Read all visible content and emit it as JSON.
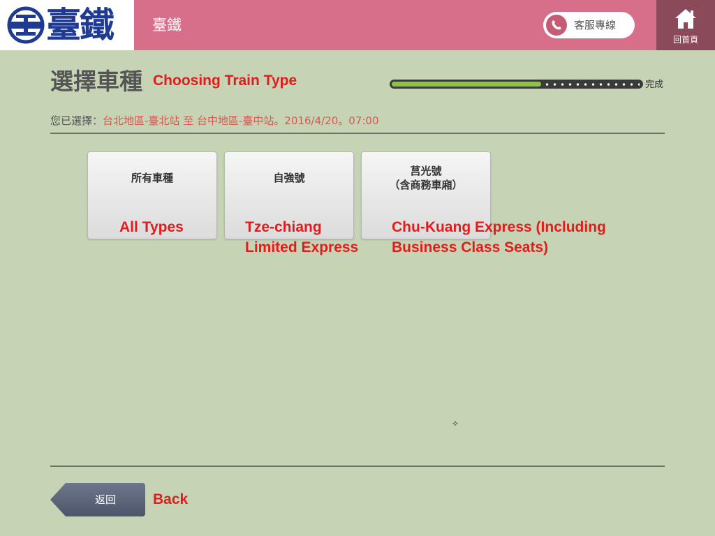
{
  "header": {
    "logo_text": "臺鐵",
    "title": "臺鐵",
    "hotline_label": "客服專線",
    "home_label": "回首頁",
    "brand_color": "#d76f8a",
    "home_bg_color": "#8b4a5a"
  },
  "main": {
    "page_title": "選擇車種",
    "annotation_title": "Choosing Train Type",
    "progress": {
      "fraction": 0.6,
      "end_label": "完成"
    },
    "selection": {
      "label": "您已選擇：",
      "value": "台北地區-臺北站 至 台中地區-臺中站。2016/4/20。07:00"
    },
    "train_types": [
      {
        "label": "所有車種",
        "annotation": "All Types"
      },
      {
        "label": "自強號",
        "annotation_line1": "Tze-chiang",
        "annotation_line2": "Limited Express"
      },
      {
        "label_line1": "莒光號",
        "label_line2": "（含商務車廂）",
        "annotation_line1": "Chu-Kuang Express (Including",
        "annotation_line2": "Business Class Seats)"
      }
    ]
  },
  "footer": {
    "back_label": "返回",
    "back_annotation": "Back"
  },
  "icons": {
    "logo": "taiwan-railway-logo-icon",
    "phone": "phone-icon",
    "home": "home-icon"
  }
}
